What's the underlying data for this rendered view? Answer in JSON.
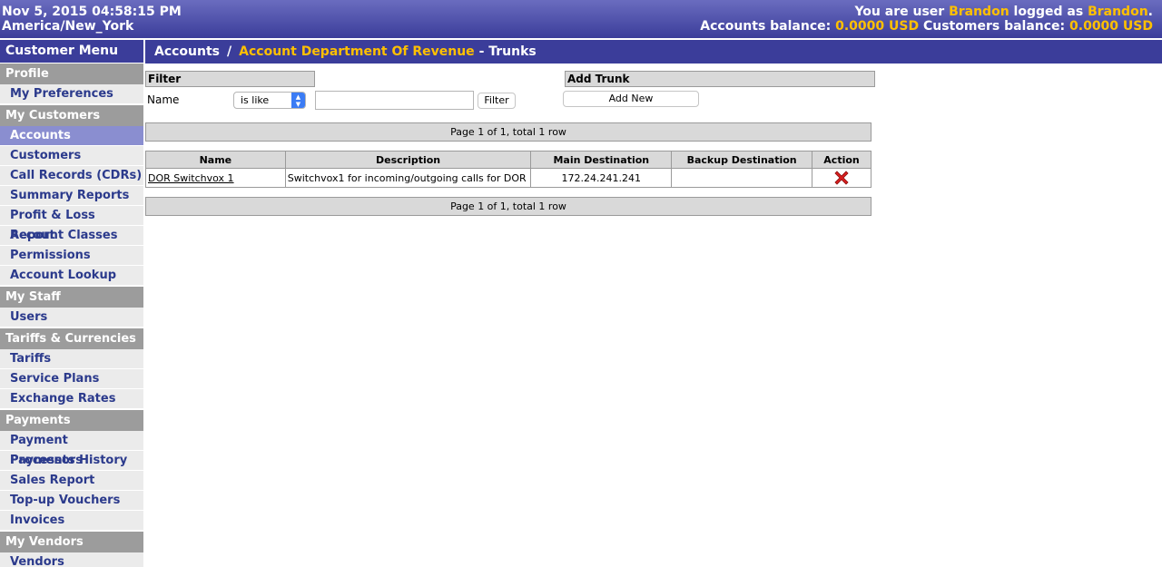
{
  "header": {
    "datetime": "Nov 5, 2015 04:58:15 PM",
    "timezone": "America/New_York",
    "user_prefix": "You are user ",
    "user": "Brandon",
    "logged_as": " logged as ",
    "logged_user": "Brandon",
    "period": ".",
    "accounts_balance_label": "Accounts balance: ",
    "accounts_balance": "0.0000 USD",
    "customers_balance_label": "Customers balance: ",
    "customers_balance": "0.0000 USD"
  },
  "sidebar": {
    "title": "Customer Menu",
    "sections": [
      {
        "label": "Profile",
        "items": [
          "My Preferences"
        ]
      },
      {
        "label": "My Customers",
        "items": [
          "Accounts",
          "Customers",
          "Call Records (CDRs)",
          "Summary Reports",
          "Profit & Loss Report",
          "Account Classes",
          "Permissions",
          "Account Lookup"
        ]
      },
      {
        "label": "My Staff",
        "items": [
          "Users"
        ]
      },
      {
        "label": "Tariffs & Currencies",
        "items": [
          "Tariffs",
          "Service Plans",
          "Exchange Rates"
        ]
      },
      {
        "label": "Payments",
        "items": [
          "Payment Processors",
          "Payments History",
          "Sales Report",
          "Top-up Vouchers",
          "Invoices"
        ]
      },
      {
        "label": "My Vendors",
        "items": [
          "Vendors"
        ]
      }
    ],
    "active_item": "Accounts"
  },
  "breadcrumb": {
    "root": "Accounts",
    "separator": "/",
    "account": "Account Department Of Revenue",
    "page": "- Trunks"
  },
  "filter": {
    "title": "Filter",
    "name_label": "Name",
    "operator": "is like",
    "value": "",
    "button": "Filter"
  },
  "add_trunk": {
    "title": "Add Trunk",
    "button": "Add New"
  },
  "pager_text": "Page 1 of 1, total 1 row",
  "table": {
    "columns": [
      "Name",
      "Description",
      "Main Destination",
      "Backup Destination",
      "Action"
    ],
    "rows": [
      {
        "name": "DOR Switchvox 1",
        "description": "Switchvox1 for incoming/outgoing calls for DOR",
        "main_destination": "172.24.241.241",
        "backup_destination": ""
      }
    ]
  },
  "colors": {
    "header_blue": "#3b3d9a",
    "highlight_yellow": "#ffc000",
    "link_blue": "#2b3a8c",
    "section_gray": "#9c9c9c"
  }
}
